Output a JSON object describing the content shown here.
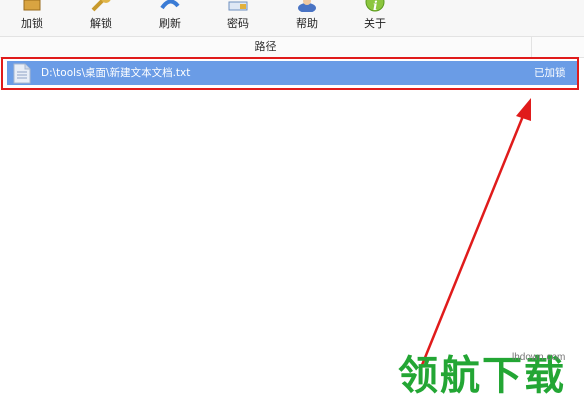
{
  "toolbar": {
    "items": [
      {
        "label": "加锁",
        "icon": "lock-icon"
      },
      {
        "label": "解锁",
        "icon": "key-icon"
      },
      {
        "label": "刷新",
        "icon": "refresh-icon"
      },
      {
        "label": "密码",
        "icon": "password-icon"
      },
      {
        "label": "帮助",
        "icon": "help-icon"
      },
      {
        "label": "关于",
        "icon": "about-icon"
      }
    ]
  },
  "table": {
    "columns": [
      "路径",
      ""
    ],
    "rows": [
      {
        "path": "D:\\tools\\桌面\\新建文本文档.txt",
        "status": "已加锁",
        "icon": "text-file-icon"
      }
    ]
  },
  "watermark": {
    "text": "领航下载",
    "url": "lhdown.com"
  },
  "colors": {
    "row_selected": "#6a9ce6",
    "annotation_red": "#e01b1b",
    "watermark_green": "#23a634"
  }
}
